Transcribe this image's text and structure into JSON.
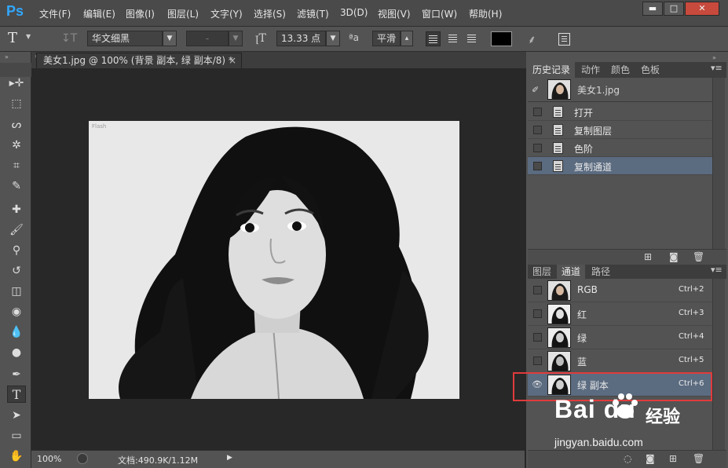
{
  "app": {
    "logo": "Ps"
  },
  "menu": [
    "文件(F)",
    "编辑(E)",
    "图像(I)",
    "图层(L)",
    "文字(Y)",
    "选择(S)",
    "滤镜(T)",
    "3D(D)",
    "视图(V)",
    "窗口(W)",
    "帮助(H)"
  ],
  "window_controls": {
    "minimize": "▬",
    "maximize": "□",
    "close": "✕"
  },
  "options": {
    "tool_icon": "T",
    "font_family": "华文细黑",
    "font_style": "-",
    "font_size": "13.33 点",
    "aa_icon": "ªa",
    "antialias": "平滑"
  },
  "document": {
    "tab_title": "美女1.jpg @ 100% (背景 副本, 绿 副本/8) *",
    "close": "×",
    "watermark": "Flash"
  },
  "status": {
    "zoom": "100%",
    "doc_info": "文档:490.9K/1.12M",
    "arrow": "▶"
  },
  "history_panel": {
    "tabs": [
      "历史记录",
      "动作",
      "颜色",
      "色板"
    ],
    "snapshot": "美女1.jpg",
    "items": [
      "打开",
      "复制图层",
      "色阶",
      "复制通道"
    ]
  },
  "channels_panel": {
    "tabs": [
      "图层",
      "通道",
      "路径"
    ],
    "channels": [
      {
        "name": "RGB",
        "shortcut": "Ctrl+2"
      },
      {
        "name": "红",
        "shortcut": "Ctrl+3"
      },
      {
        "name": "绿",
        "shortcut": "Ctrl+4"
      },
      {
        "name": "蓝",
        "shortcut": "Ctrl+5"
      },
      {
        "name": "绿 副本",
        "shortcut": "Ctrl+6"
      }
    ]
  },
  "brand": {
    "main": "Bai du",
    "cn": "经验",
    "sub": "jingyan.baidu.com"
  },
  "icons": [
    "search-icon",
    "eye-icon",
    "new-channel-icon",
    "trash-icon",
    "camera-icon"
  ]
}
